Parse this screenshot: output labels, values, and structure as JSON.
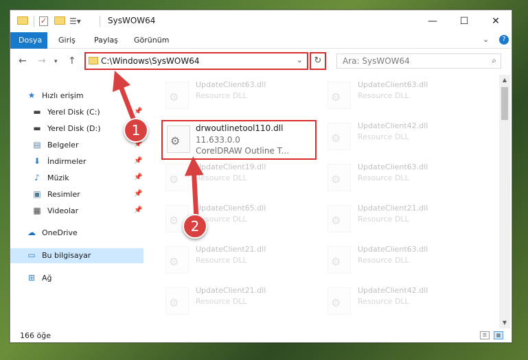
{
  "window": {
    "title": "SysWOW64",
    "controls": {
      "minimize": "—",
      "maximize": "☐",
      "close": "✕"
    }
  },
  "ribbon": {
    "tabs": [
      "Dosya",
      "Giriş",
      "Paylaş",
      "Görünüm"
    ],
    "active_tab": "Dosya",
    "collapse_glyph": "⌄",
    "help_glyph": "?"
  },
  "address": {
    "path": "C:\\Windows\\SysWOW64",
    "search_placeholder": "Ara: SysWOW64"
  },
  "nav": {
    "items": [
      {
        "label": "Hızlı erişim",
        "icon": "star-icon",
        "pinned": false
      },
      {
        "label": "Yerel Disk (C:)",
        "icon": "drive-icon",
        "pinned": true
      },
      {
        "label": "Yerel Disk (D:)",
        "icon": "drive-icon",
        "pinned": false
      },
      {
        "label": "Belgeler",
        "icon": "document-icon",
        "pinned": true
      },
      {
        "label": "İndirmeler",
        "icon": "download-icon",
        "pinned": true
      },
      {
        "label": "Müzik",
        "icon": "music-icon",
        "pinned": true
      },
      {
        "label": "Resimler",
        "icon": "picture-icon",
        "pinned": true
      },
      {
        "label": "Videolar",
        "icon": "video-icon",
        "pinned": true
      },
      {
        "label": "OneDrive",
        "icon": "cloud-icon",
        "pinned": false
      },
      {
        "label": "Bu bilgisayar",
        "icon": "computer-icon",
        "pinned": false,
        "selected": true
      },
      {
        "label": "Ağ",
        "icon": "network-icon",
        "pinned": false
      }
    ]
  },
  "files": {
    "highlighted": {
      "name": "drwoutlinetool110.dll",
      "version": "11.633.0.0",
      "description": "CorelDRAW Outline T..."
    },
    "background": [
      {
        "name": "UpdateClient63.dll",
        "type": "Resource DLL"
      },
      {
        "name": "UpdateClient63.dll",
        "type": "Resource DLL"
      },
      {
        "name": "UpdateClient42.dll",
        "type": "Resource DLL"
      },
      {
        "name": "UpdateClient19.dll",
        "type": "Resource DLL"
      },
      {
        "name": "UpdateClient63.dll",
        "type": "Resource DLL"
      },
      {
        "name": "UpdateClient65.dll",
        "type": "Resource DLL"
      },
      {
        "name": "UpdateClient21.dll",
        "type": "Resource DLL"
      },
      {
        "name": "UpdateClient21.dll",
        "type": "Resource DLL"
      },
      {
        "name": "UpdateClient63.dll",
        "type": "Resource DLL"
      },
      {
        "name": "UpdateClient21.dll",
        "type": "Resource DLL"
      },
      {
        "name": "UpdateClient42.dll",
        "type": "Resource DLL"
      }
    ]
  },
  "status": {
    "item_count": "166 öğe"
  },
  "annotations": {
    "step1": "1",
    "step2": "2",
    "color": "#d94040"
  }
}
